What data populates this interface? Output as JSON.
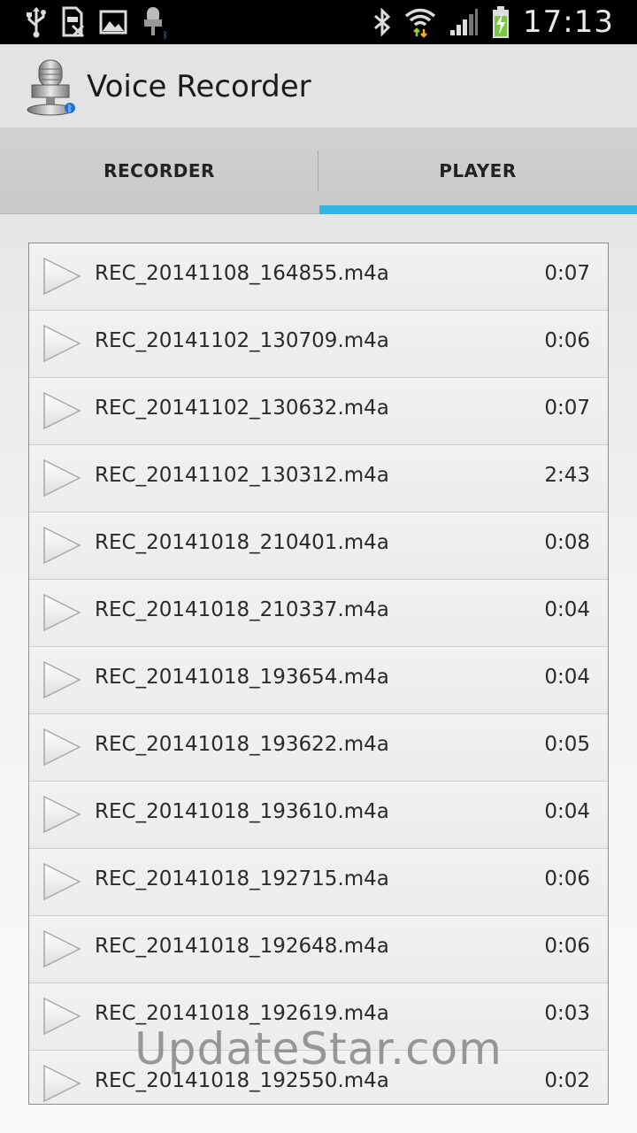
{
  "status_bar": {
    "time": "17:13",
    "left_icons": [
      "usb-icon",
      "sim-card-off-icon",
      "image-icon",
      "microphone-bluetooth-icon"
    ],
    "right_icons": [
      "bluetooth-icon",
      "wifi-icon",
      "signal-icon",
      "battery-charging-icon"
    ]
  },
  "action_bar": {
    "title": "Voice Recorder",
    "icon": "microphone-app-icon"
  },
  "tabs": {
    "recorder": "RECORDER",
    "player": "PLAYER",
    "selected": "PLAYER",
    "indicator_color": "#33b5e5"
  },
  "recordings": [
    {
      "name": "REC_20141108_164855.m4a",
      "duration": "0:07"
    },
    {
      "name": "REC_20141102_130709.m4a",
      "duration": "0:06"
    },
    {
      "name": "REC_20141102_130632.m4a",
      "duration": "0:07"
    },
    {
      "name": "REC_20141102_130312.m4a",
      "duration": "2:43"
    },
    {
      "name": "REC_20141018_210401.m4a",
      "duration": "0:08"
    },
    {
      "name": "REC_20141018_210337.m4a",
      "duration": "0:04"
    },
    {
      "name": "REC_20141018_193654.m4a",
      "duration": "0:04"
    },
    {
      "name": "REC_20141018_193622.m4a",
      "duration": "0:05"
    },
    {
      "name": "REC_20141018_193610.m4a",
      "duration": "0:04"
    },
    {
      "name": "REC_20141018_192715.m4a",
      "duration": "0:06"
    },
    {
      "name": "REC_20141018_192648.m4a",
      "duration": "0:06"
    },
    {
      "name": "REC_20141018_192619.m4a",
      "duration": "0:03"
    },
    {
      "name": "REC_20141018_192550.m4a",
      "duration": "0:02"
    }
  ],
  "watermark": "UpdateStar.com"
}
